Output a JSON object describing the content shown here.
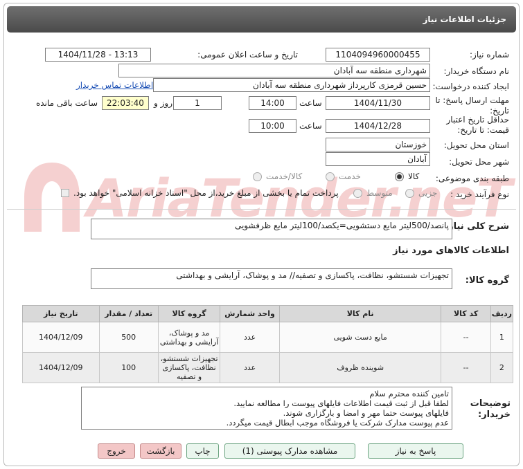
{
  "header": {
    "title": "جزئیات اطلاعات نیاز"
  },
  "fields": {
    "need_number_label": "شماره نیاز:",
    "need_number": "1104094960000455",
    "announce_label": "تاریخ و ساعت اعلان عمومی:",
    "announce_value": "1404/11/28 - 13:13",
    "buyer_org_label": "نام دستگاه خریدار:",
    "buyer_org": "شهرداری منطقه سه آبادان",
    "creator_label": "ایجاد کننده درخواست:",
    "creator": "حسین قرمزی کارپرداز شهرداری منطقه سه آبادان",
    "contact_link": "اطلاعات تماس خریدار",
    "deadline_label": "مهلت ارسال پاسخ: تا تاریخ:",
    "deadline_date": "1404/11/30",
    "time_label": "ساعت",
    "deadline_time": "14:00",
    "days": "1",
    "days_and": "روز و",
    "remaining_time": "22:03:40",
    "remaining_label": "ساعت باقی مانده",
    "validity_label": "حداقل تاریخ اعتبار قیمت: تا تاریخ:",
    "validity_date": "1404/12/28",
    "validity_time": "10:00",
    "province_label": "استان محل تحویل:",
    "province": "خوزستان",
    "city_label": "شهر محل تحویل:",
    "city": "آبادان",
    "category_label": "طبقه بندی موضوعی:",
    "category_options": [
      "کالا",
      "خدمت",
      "کالا/خدمت"
    ],
    "category_selected": "کالا",
    "process_label": "نوع فرآیند خرید :",
    "process_options": [
      "جزیی",
      "متوسط"
    ],
    "process_note": "پرداخت تمام یا بخشی از مبلغ خرید،از محل \"اسناد خزانه اسلامی\" خواهد بود."
  },
  "description": {
    "label": "شرح کلی نیاز:",
    "value": "پانصد/500لیتر مایع دستشویی=یکصد/100لیتر مایع ظرفشویی"
  },
  "goods_info": {
    "section_title": "اطلاعات کالاهای مورد نیاز",
    "group_label": "گروه کالا:",
    "group_value": "تجهیزات شستشو، نظافت، پاکسازی و تصفیه// مد و پوشاک، آرایشی و بهداشتی"
  },
  "table": {
    "headers": [
      "ردیف",
      "کد کالا",
      "نام کالا",
      "واحد شمارش",
      "گروه کالا",
      "تعداد / مقدار",
      "تاریخ نیاز"
    ],
    "rows": [
      {
        "row": "1",
        "code": "--",
        "name": "مایع دست شویی",
        "unit": "عدد",
        "group": "مد و پوشاک، آرایشی و بهداشتی",
        "qty": "500",
        "date": "1404/12/09"
      },
      {
        "row": "2",
        "code": "--",
        "name": "شوینده ظروف",
        "unit": "عدد",
        "group": "تجهیزات شستشو، نظافت، پاکسازی و تصفیه",
        "qty": "100",
        "date": "1404/12/09"
      }
    ]
  },
  "buyer_notes": {
    "label": "توضیحات خریدار:",
    "lines": [
      "تامین کننده محترم سلام",
      "لطفا قبل از ثبت قیمت اطلاعات فایلهای پیوست را مطالعه نمایید.",
      "فایلهای پیوست حتما مهر و امضا و بارگزاری شوند.",
      "عدم پیوست مدارک شرکت یا فروشگاه موجب ابطال قیمت میگردد."
    ]
  },
  "buttons": {
    "reply": "پاسخ به نیاز",
    "attachments": "مشاهده مدارک پیوستی (1)",
    "print": "چاپ",
    "back": "بازگشت",
    "exit": "خروج"
  },
  "watermark": {
    "text": "AriaTender.neT"
  },
  "colors": {
    "header_bg": "#555555",
    "link": "#1a4fb5",
    "remaining_bg": "#ffffcc",
    "button_green": "#eaf6ee",
    "button_red": "#f3c7c7"
  }
}
